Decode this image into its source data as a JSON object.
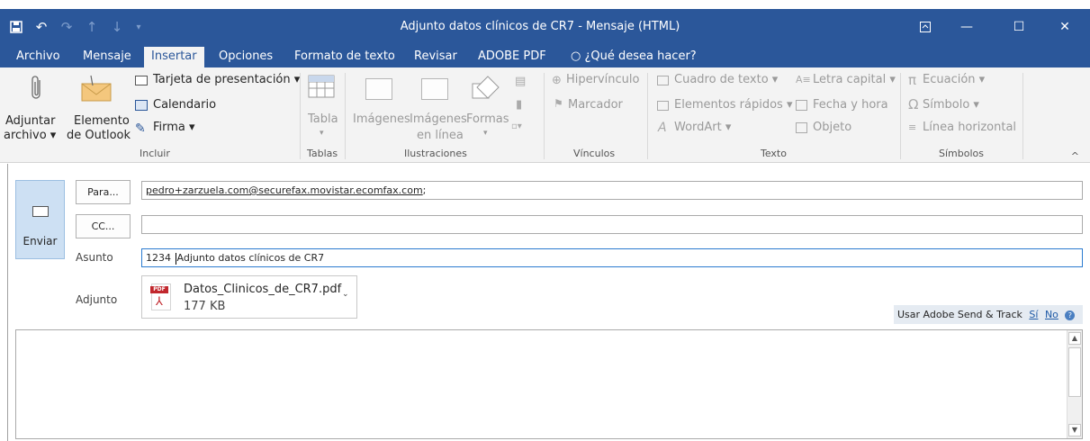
{
  "window": {
    "title": "Adjunto datos clínicos de CR7 - Mensaje (HTML)"
  },
  "tabs": [
    "Archivo",
    "Mensaje",
    "Insertar",
    "Opciones",
    "Formato de texto",
    "Revisar",
    "ADOBE PDF",
    "¿Qué desea hacer?"
  ],
  "ribbon": {
    "incluir": {
      "adjuntar_line1": "Adjuntar",
      "adjuntar_line2": "archivo ▾",
      "elemento_line1": "Elemento",
      "elemento_line2": "de Outlook",
      "tarjeta": "Tarjeta de presentación ▾",
      "calendario": "Calendario",
      "firma": "Firma ▾",
      "group": "Incluir"
    },
    "tablas": {
      "tabla": "Tabla",
      "group": "Tablas"
    },
    "ilustraciones": {
      "imagenes": "Imágenes",
      "imagenes_linea_1": "Imágenes",
      "imagenes_linea_2": "en línea",
      "formas": "Formas",
      "group": "Ilustraciones"
    },
    "vinculos": {
      "hipervinculo": "Hipervínculo",
      "marcador": "Marcador",
      "group": "Vínculos"
    },
    "texto": {
      "cuadro": "Cuadro de texto ▾",
      "elementos": "Elementos rápidos ▾",
      "wordart": "WordArt ▾",
      "letra": "Letra capital ▾",
      "fecha": "Fecha y hora",
      "objeto": "Objeto",
      "group": "Texto"
    },
    "simbolos": {
      "ecuacion": "Ecuación ▾",
      "simbolo": "Símbolo ▾",
      "linea": "Línea horizontal",
      "group": "Símbolos"
    }
  },
  "compose": {
    "send_label": "Enviar",
    "para_label": "Para...",
    "to_value": "pedro+zarzuela.com@securefax.movistar.ecomfax.com",
    "to_suffix": ";",
    "cc_label": "CC...",
    "cc_value": "",
    "subject_label": "Asunto",
    "subject_before_caret": "1234 ",
    "subject_after_caret": "Adjunto datos clínicos de CR7",
    "attach_label": "Adjunto",
    "attachment": {
      "name": "Datos_Clinicos_de_CR7.pdf",
      "size": "177 KB",
      "type_tag": "PDF"
    }
  },
  "adobe": {
    "text": "Usar Adobe Send & Track",
    "yes": "Sí",
    "no": "No"
  }
}
